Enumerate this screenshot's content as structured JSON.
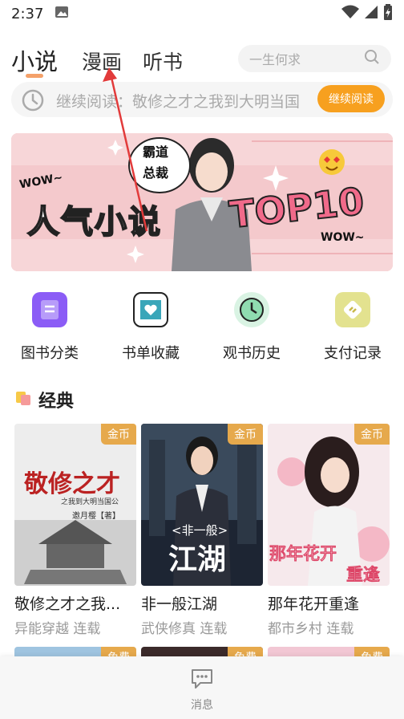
{
  "status_bar": {
    "time": "2:37"
  },
  "tabs": [
    {
      "label": "小说",
      "active": true
    },
    {
      "label": "漫画",
      "active": false
    },
    {
      "label": "听书",
      "active": false
    }
  ],
  "search": {
    "placeholder": "一生何求"
  },
  "continue_reading": {
    "text": "继续阅读：敬修之才之我到大明当国公",
    "button": "继续阅读"
  },
  "banner": {
    "main_text": "人气小说",
    "badge_text": "TOP10",
    "bubble_line1": "霸道",
    "bubble_line2": "总裁",
    "wow_left": "WOW~",
    "wow_right": "WOW~"
  },
  "quick_links": [
    {
      "label": "图书分类",
      "icon": "book-category-icon",
      "color": "#8b5cf6"
    },
    {
      "label": "书单收藏",
      "icon": "heart-collection-icon",
      "color": "#3aa6b9"
    },
    {
      "label": "观书历史",
      "icon": "history-clock-icon",
      "color": "#2fa36b"
    },
    {
      "label": "支付记录",
      "icon": "payment-record-icon",
      "color": "#c8b84a"
    }
  ],
  "section": {
    "title": "经典"
  },
  "books": [
    {
      "title": "敬修之才之我...",
      "meta": "异能穿越 连载",
      "badge": "金币",
      "cover_title": "敬修之才",
      "cover_sub": "之我到大明当国公",
      "cover_author": "邀月樱【著】"
    },
    {
      "title": "非一般江湖",
      "meta": "武侠修真 连载",
      "badge": "金币",
      "cover_title": "江湖",
      "cover_sub": "<非一般>"
    },
    {
      "title": "那年花开重逢",
      "meta": "都市乡村 连载",
      "badge": "金币",
      "cover_title": "那年花开",
      "cover_sub": "重逢"
    }
  ],
  "row2_badges": [
    "免费",
    "免费",
    "免费"
  ],
  "bottom_nav": {
    "message_label": "消息"
  },
  "colors": {
    "accent": "#f7a01f",
    "tab_indicator": "#f4a16a",
    "badge": "#e6a94c"
  }
}
